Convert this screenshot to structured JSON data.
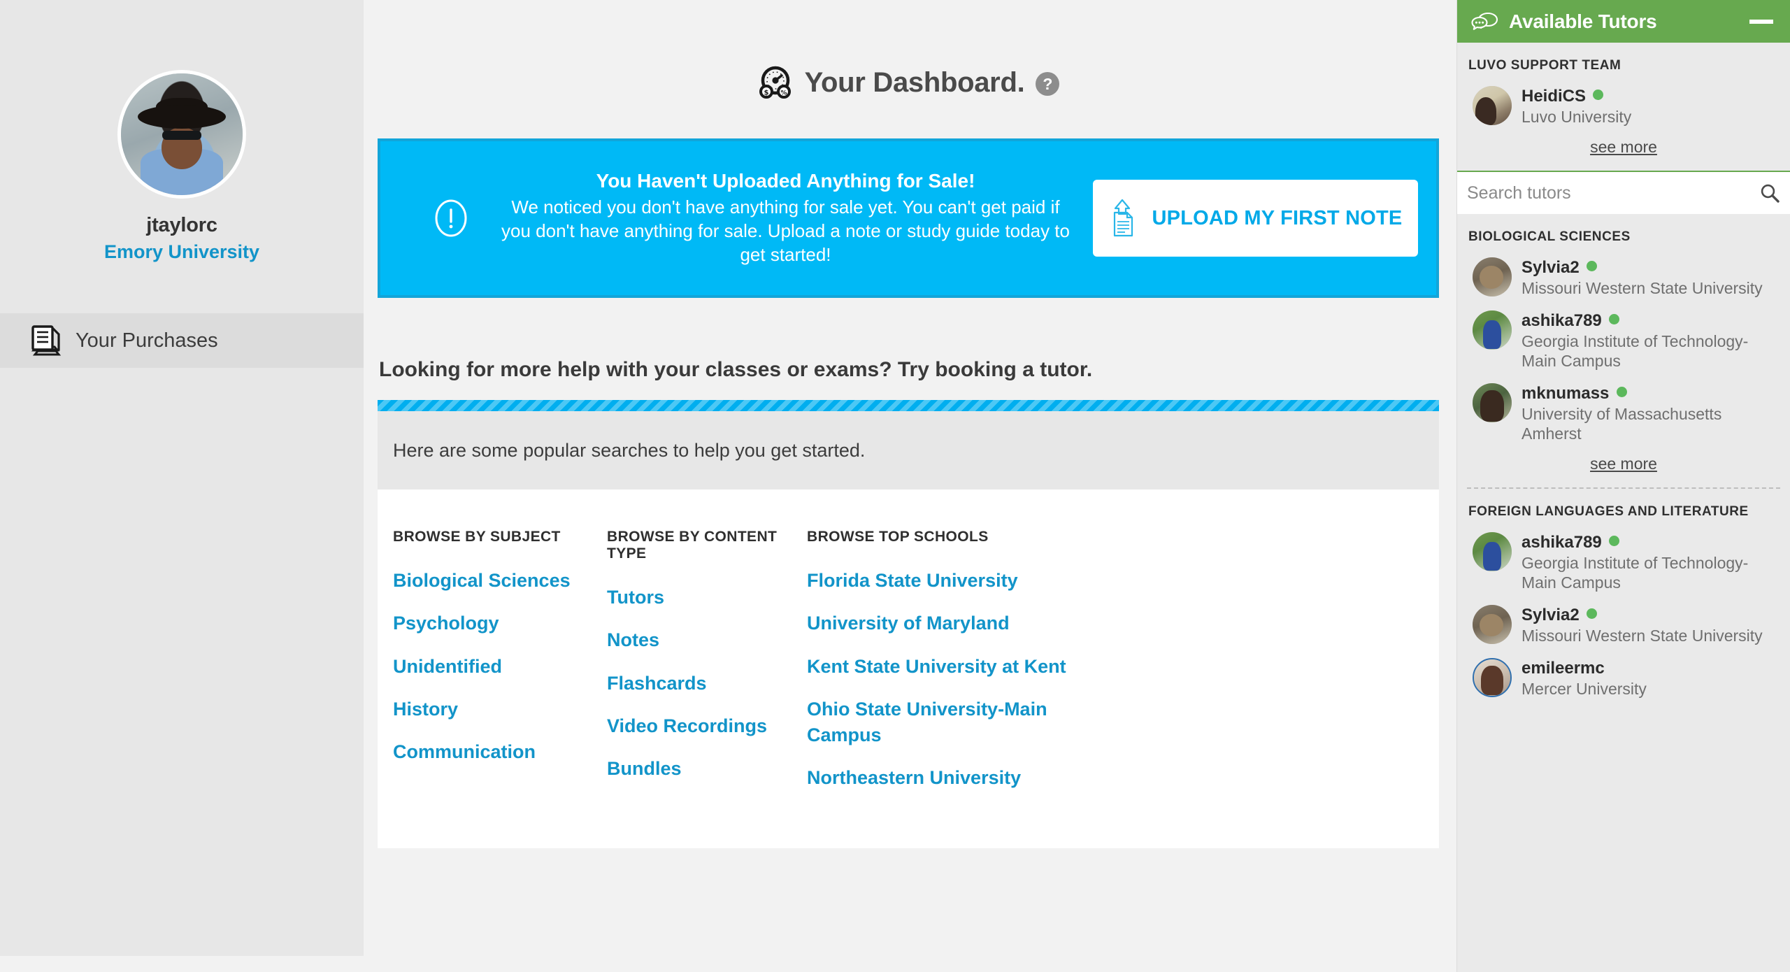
{
  "sidebar": {
    "profile": {
      "username": "jtaylorc",
      "school": "Emory University",
      "avatar_icon": "user-avatar-photo"
    },
    "nav": [
      {
        "label": "Your Purchases",
        "icon": "documents-stack-icon"
      }
    ]
  },
  "header": {
    "title": "Your Dashboard.",
    "icon": "dashboard-gauge-icon",
    "help_label": "?"
  },
  "alert": {
    "icon": "exclamation-circle-icon",
    "heading": "You Haven't Uploaded Anything for Sale!",
    "body": "We noticed you don't have anything for sale yet. You can't get paid if you don't have anything for sale. Upload a note or study guide today to get started!",
    "button_label": "UPLOAD MY FIRST NOTE",
    "button_icon": "upload-document-icon",
    "bg_color": "#00b9f6",
    "border_color": "#12a5d9"
  },
  "tutor_promo": {
    "prompt": "Looking for more help with your classes or exams? Try booking a tutor.",
    "popular_text": "Here are some popular searches to help you get started.",
    "stripe_color": "#00aeef"
  },
  "browse": {
    "columns": [
      {
        "heading": "BROWSE BY SUBJECT",
        "links": [
          "Biological Sciences",
          "Psychology",
          "Unidentified",
          "History",
          "Communication"
        ]
      },
      {
        "heading": "BROWSE BY CONTENT TYPE",
        "links": [
          "Tutors",
          "Notes",
          "Flashcards",
          "Video Recordings",
          "Bundles"
        ]
      },
      {
        "heading": "BROWSE TOP SCHOOLS",
        "links": [
          "Florida State University",
          "University of Maryland",
          "Kent State University at Kent",
          "Ohio State University-Main Campus",
          "Northeastern University"
        ]
      }
    ],
    "link_color": "#1294c9"
  },
  "tutor_panel": {
    "title": "Available Tutors",
    "title_icon": "chat-bubbles-icon",
    "minimize_label": "minimize",
    "header_color": "#67a94f",
    "online_color": "#5cb85c",
    "search": {
      "placeholder": "Search tutors",
      "value": "",
      "icon": "search-icon"
    },
    "see_more_label": "see more",
    "sections": [
      {
        "heading": "LUVO SUPPORT TEAM",
        "show_see_more": true,
        "tutors": [
          {
            "name": "HeidiCS",
            "school": "Luvo University",
            "online": true,
            "avatar": "tutor-avatar-heidics",
            "ring": false
          }
        ]
      },
      {
        "heading": "BIOLOGICAL SCIENCES",
        "show_see_more": true,
        "tutors": [
          {
            "name": "Sylvia2",
            "school": "Missouri Western State University",
            "online": true,
            "avatar": "tutor-avatar-sylvia2",
            "ring": false
          },
          {
            "name": "ashika789",
            "school": "Georgia Institute of Technology-Main Campus",
            "online": true,
            "avatar": "tutor-avatar-ashika789",
            "ring": false
          },
          {
            "name": "mknumass",
            "school": "University of Massachusetts Amherst",
            "online": true,
            "avatar": "tutor-avatar-mknumass",
            "ring": false
          }
        ]
      },
      {
        "heading": "FOREIGN LANGUAGES AND LITERATURE",
        "show_see_more": false,
        "tutors": [
          {
            "name": "ashika789",
            "school": "Georgia Institute of Technology-Main Campus",
            "online": true,
            "avatar": "tutor-avatar-ashika789",
            "ring": false
          },
          {
            "name": "Sylvia2",
            "school": "Missouri Western State University",
            "online": true,
            "avatar": "tutor-avatar-sylvia2",
            "ring": false
          },
          {
            "name": "emileermc",
            "school": "Mercer University",
            "online": false,
            "avatar": "tutor-avatar-emileermc",
            "ring": true
          }
        ]
      }
    ]
  }
}
